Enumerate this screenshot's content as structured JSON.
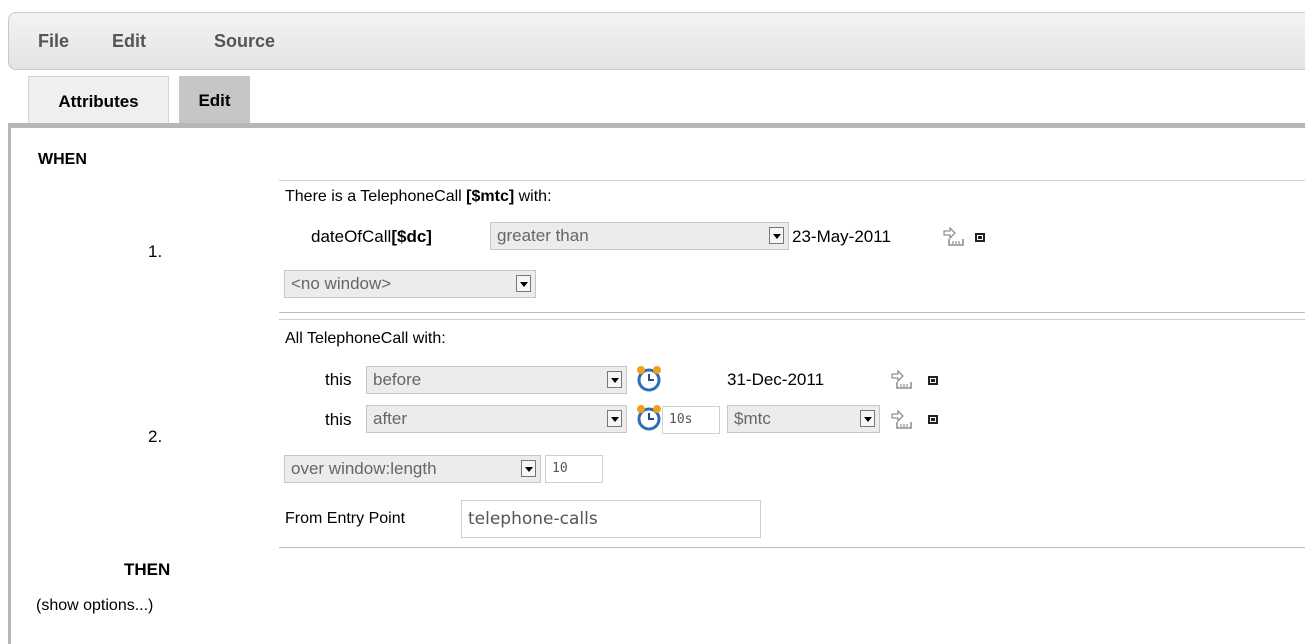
{
  "menu": {
    "file": "File",
    "edit": "Edit",
    "source": "Source"
  },
  "tabs": {
    "attributes": "Attributes",
    "edit": "Edit"
  },
  "when_label": "WHEN",
  "then_label": "THEN",
  "show_options": "(show options...)",
  "rule1": {
    "number": "1.",
    "header_prefix": "There is a TelephoneCall ",
    "header_binding": "[$mtc]",
    "header_suffix": " with:",
    "field": "dateOfCall",
    "field_binding": "[$dc]",
    "operator": "greater than",
    "value": "23-May-2011",
    "window": "<no window>"
  },
  "rule2": {
    "number": "2.",
    "header": "All TelephoneCall with:",
    "constraints": [
      {
        "subject": "this",
        "operator": "before",
        "value": "31-Dec-2011"
      },
      {
        "subject": "this",
        "operator": "after",
        "offset": "10s",
        "variable": "$mtc"
      }
    ],
    "window": "over window:length",
    "window_value": "10",
    "entry_point_label": "From Entry Point",
    "entry_point_value": "telephone-calls"
  },
  "icons": {
    "alarm": "alarm-clock-icon",
    "expand": "expand-field-icon",
    "remove": "remove-constraint-icon"
  },
  "colors": {
    "menubar": "#e9e9e9",
    "active_tab": "#c6c6c6",
    "select_bg": "#ececec"
  }
}
